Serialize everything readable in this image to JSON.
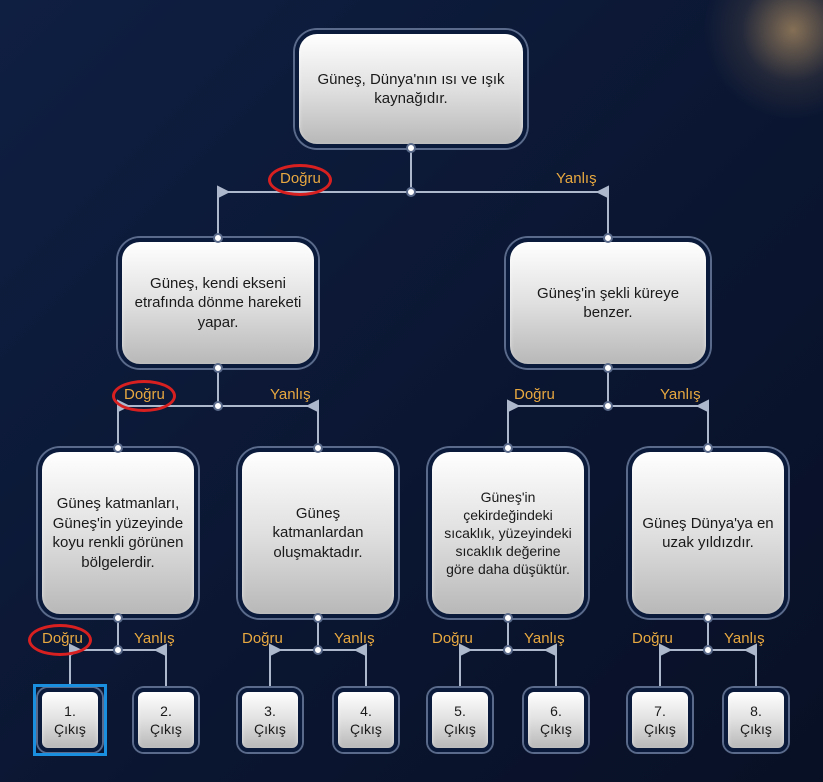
{
  "labels": {
    "true": "Doğru",
    "false": "Yanlış"
  },
  "root": {
    "text": "Güneş, Dünya'nın ısı ve ışık kaynağıdır."
  },
  "level2": {
    "left": {
      "text": "Güneş, kendi ekseni etrafında dönme hareketi yapar."
    },
    "right": {
      "text": "Güneş'in şekli küreye benzer."
    }
  },
  "level3": {
    "n1": {
      "text": "Güneş katmanları, Güneş'in yüzeyinde koyu renkli görünen bölgelerdir."
    },
    "n2": {
      "text": "Güneş katmanlardan oluşmaktadır."
    },
    "n3": {
      "text": "Güneş'in çekirdeğindeki sıcaklık, yüzeyindeki sıcaklık değerine göre daha düşüktür."
    },
    "n4": {
      "text": "Güneş Dünya'ya en uzak yıldızdır."
    }
  },
  "leaves": {
    "l1": "1. Çıkış",
    "l2": "2. Çıkış",
    "l3": "3. Çıkış",
    "l4": "4. Çıkış",
    "l5": "5. Çıkış",
    "l6": "6. Çıkış",
    "l7": "7. Çıkış",
    "l8": "8. Çıkış"
  },
  "chart_data": {
    "type": "table",
    "note": "Binary decision tree. Each node is a true/false statement; 'Doğru' branch = statement accepted, 'Yanlış' = rejected. Leaves are exit labels 1–8.",
    "structure": {
      "root": "Güneş, Dünya'nın ısı ve ışık kaynağıdır.",
      "true": {
        "node": "Güneş, kendi ekseni etrafında dönme hareketi yapar.",
        "true": {
          "node": "Güneş katmanları, Güneş'in yüzeyinde koyu renkli görünen bölgelerdir.",
          "true": "1. Çıkış",
          "false": "2. Çıkış"
        },
        "false": {
          "node": "Güneş katmanlardan oluşmaktadır.",
          "true": "3. Çıkış",
          "false": "4. Çıkış"
        }
      },
      "false": {
        "node": "Güneş'in şekli küreye benzer.",
        "true": {
          "node": "Güneş'in çekirdeğindeki sıcaklık, yüzeyindeki sıcaklık değerine göre daha düşüktür.",
          "true": "5. Çıkış",
          "false": "6. Çıkış"
        },
        "false": {
          "node": "Güneş Dünya'ya en uzak yıldızdır.",
          "true": "7. Çıkış",
          "false": "8. Çıkış"
        }
      }
    },
    "highlighted_path": [
      "Doğru",
      "Doğru",
      "Doğru"
    ],
    "highlighted_leaf": "1. Çıkış"
  }
}
